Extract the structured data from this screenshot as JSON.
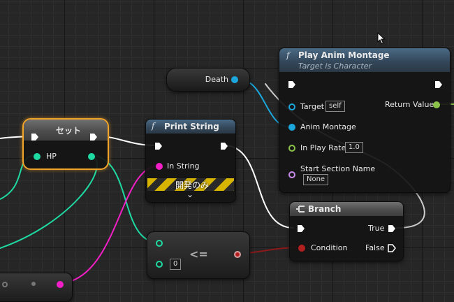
{
  "nodes": {
    "death": {
      "label": "Death"
    },
    "set": {
      "title": "セット",
      "var": "HP"
    },
    "print": {
      "fn_icon": "f",
      "title": "Print String",
      "in_string": "In String",
      "dev_only": "開発のみ",
      "expand": "⌄"
    },
    "play": {
      "fn_icon": "f",
      "title": "Play Anim Montage",
      "subtitle": "Target is Character",
      "target": "Target",
      "target_val": "self",
      "montage": "Anim Montage",
      "rate": "In Play Rate",
      "rate_val": "1.0",
      "section": "Start Section Name",
      "section_val": "None",
      "ret": "Return Value"
    },
    "branch": {
      "title": "Branch",
      "true": "True",
      "false": "False",
      "condition": "Condition"
    },
    "cmp": {
      "op": "<=",
      "b_val": "0"
    }
  },
  "colors": {
    "exec": "#ffffff",
    "object": "#1ba6dc",
    "float": "#8bc34a",
    "integer": "#1ed9a1",
    "string": "#f21fc6",
    "bool": "#b21f1f",
    "name": "#c98bea",
    "accent_set": "#f0a42a"
  }
}
